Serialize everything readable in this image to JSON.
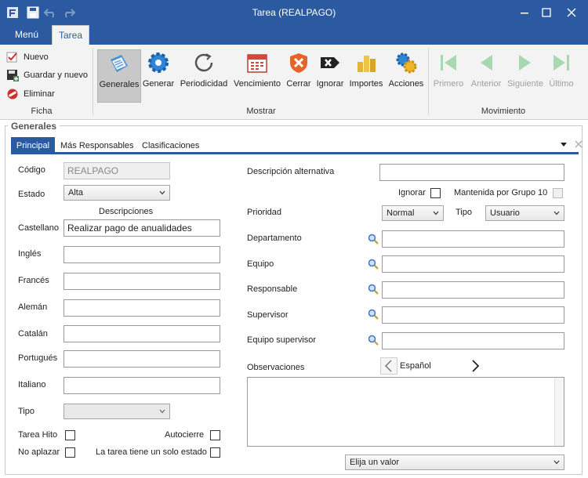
{
  "window": {
    "title": "Tarea (REALPAGO)"
  },
  "ribbon_tabs": {
    "menu": "Menú",
    "active": "Tarea"
  },
  "ficha": {
    "label": "Ficha",
    "nuevo": "Nuevo",
    "guardar_nuevo": "Guardar y nuevo",
    "eliminar": "Eliminar"
  },
  "mostrar": {
    "label": "Mostrar",
    "buttons": [
      "Generales",
      "Generar",
      "Periodicidad",
      "Vencimiento",
      "Cerrar",
      "Ignorar",
      "Importes",
      "Acciones"
    ]
  },
  "movimiento": {
    "label": "Movimiento",
    "buttons": [
      "Primero",
      "Anterior",
      "Siguiente",
      "Último"
    ]
  },
  "panel": {
    "title": "Generales",
    "tabs": [
      "Principal",
      "Más Responsables",
      "Clasificaciones"
    ]
  },
  "form": {
    "codigo_label": "Código",
    "codigo_value": "REALPAGO",
    "estado_label": "Estado",
    "estado_value": "Alta",
    "descripciones_header": "Descripciones",
    "languages": [
      {
        "label": "Castellano",
        "value": "Realizar pago de anualidades"
      },
      {
        "label": "Inglés",
        "value": ""
      },
      {
        "label": "Francés",
        "value": ""
      },
      {
        "label": "Alemán",
        "value": ""
      },
      {
        "label": "Catalán",
        "value": ""
      },
      {
        "label": "Portugués",
        "value": ""
      },
      {
        "label": "Italiano",
        "value": ""
      }
    ],
    "tipo_label": "Tipo",
    "tipo_value": "",
    "tarea_hito": "Tarea Hito",
    "autocierre": "Autocierre",
    "no_aplazar": "No aplazar",
    "solo_estado": "La tarea tiene un solo estado",
    "desc_alt_label": "Descripción alternativa",
    "desc_alt_value": "",
    "ignorar_label": "Ignorar",
    "mantenida_label": "Mantenida por Grupo 10",
    "prioridad_label": "Prioridad",
    "prioridad_value": "Normal",
    "tipo2_label": "Tipo",
    "tipo2_value": "Usuario",
    "lookups": [
      {
        "label": "Departamento",
        "value": ""
      },
      {
        "label": "Equipo",
        "value": ""
      },
      {
        "label": "Responsable",
        "value": ""
      },
      {
        "label": "Supervisor",
        "value": ""
      },
      {
        "label": "Equipo supervisor",
        "value": ""
      }
    ],
    "observaciones_label": "Observaciones",
    "observaciones_lang": "Español",
    "elija_value": "Elija un valor"
  },
  "colors": {
    "accent": "#2c5aa0",
    "ribbon_bg": "#f3f3f3"
  }
}
